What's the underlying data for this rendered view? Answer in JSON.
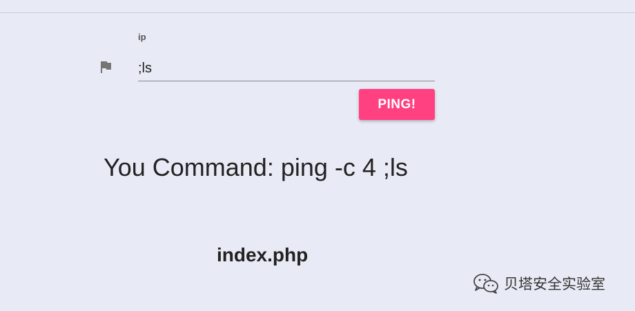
{
  "form": {
    "ip_label": "ip",
    "ip_value": ";ls",
    "ping_button_label": "PING!"
  },
  "result": {
    "command_text": "You Command: ping -c 4 ;ls",
    "output": "index.php"
  },
  "watermark": {
    "text": "贝塔安全实验室"
  },
  "colors": {
    "background": "#e8eaf5",
    "accent": "#ff4081",
    "text": "#222222"
  },
  "icons": {
    "field_icon": "flag-icon",
    "watermark_icon": "wechat-icon"
  }
}
